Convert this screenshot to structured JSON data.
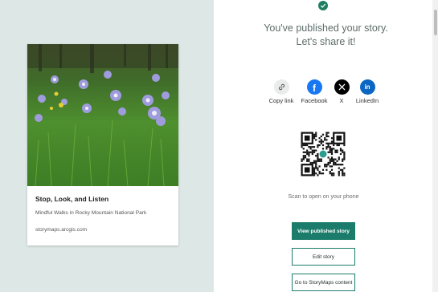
{
  "story": {
    "title": "Stop, Look, and Listen",
    "subtitle": "Mindful Walks in Rocky Mountain National Park",
    "url": "storymaps.arcgis.com"
  },
  "headline": {
    "line1": "You've published your story.",
    "line2": "Let's share it!"
  },
  "share": [
    {
      "label": "Copy link",
      "icon": "link-icon"
    },
    {
      "label": "Facebook",
      "icon": "facebook-icon"
    },
    {
      "label": "X",
      "icon": "x-icon"
    },
    {
      "label": "LinkedIn",
      "icon": "linkedin-icon"
    }
  ],
  "qr": {
    "caption": "Scan to open on your phone"
  },
  "buttons": {
    "view": "View published story",
    "edit": "Edit story",
    "goto": "Go to StoryMaps content"
  },
  "colors": {
    "accent": "#1c7c6b",
    "left_background": "#dde7e5",
    "facebook": "#1877f2",
    "linkedin": "#0a66c2"
  }
}
